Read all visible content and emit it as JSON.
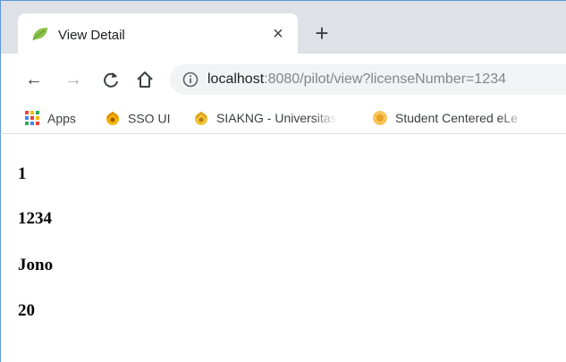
{
  "colors": {
    "tabstrip_bg": "#dee1e6",
    "omnibox_bg": "#f1f3f4",
    "leaf_icon": "#8bc34a",
    "window_border": "#5b9bd5"
  },
  "tab": {
    "title": "View Detail",
    "favicon": "leaf-icon",
    "close_glyph": "×"
  },
  "newtab_glyph": "+",
  "toolbar": {
    "back_glyph": "←",
    "forward_glyph": "→",
    "reload_glyph": "C",
    "home_glyph": "⌂"
  },
  "address": {
    "host": "localhost",
    "rest": ":8080/pilot/view?licenseNumber=1234"
  },
  "bookmarks": [
    {
      "label": "Apps",
      "icon": "apps-grid-icon"
    },
    {
      "label": "SSO UI",
      "icon": "ui-logo-icon"
    },
    {
      "label": "SIAKNG - Universitas",
      "icon": "ui-logo-icon"
    },
    {
      "label": "Student Centered eLe",
      "icon": "ui-logo-icon"
    }
  ],
  "content": {
    "fields": [
      "1",
      "1234",
      "Jono",
      "20"
    ]
  }
}
